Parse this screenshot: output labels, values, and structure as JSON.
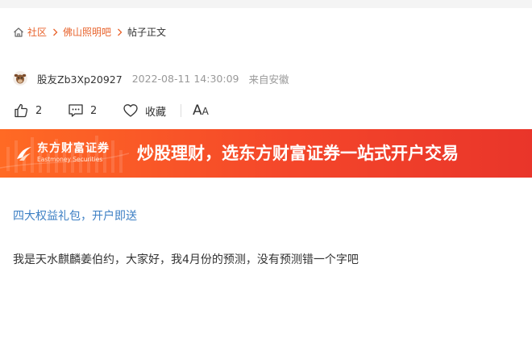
{
  "breadcrumb": {
    "home_label": "社区",
    "bar_label": "佛山照明吧",
    "current_label": "帖子正文"
  },
  "author": {
    "username": "股友Zb3Xp20927",
    "time": "2022-08-11 14:30:09",
    "source": "来自安徽"
  },
  "actions": {
    "like_count": "2",
    "comment_count": "2",
    "favorite_label": "收藏",
    "font_large": "A",
    "font_small": "A"
  },
  "banner": {
    "logo_cn": "东方财富证券",
    "logo_en": "Eastmoney Securities",
    "slogan": "炒股理财，选东方财富证券一站式开户交易",
    "colors": {
      "start": "#ff6a24",
      "end": "#e9352a"
    }
  },
  "content": {
    "promo_link": "四大权益礼包，开户即送",
    "body_text": "我是天水麒麟姜伯约，大家好，我4月份的预测，没有预测错一个字吧"
  },
  "colors": {
    "accent": "#e8632c",
    "link": "#3c7fc4",
    "muted": "#999999"
  }
}
